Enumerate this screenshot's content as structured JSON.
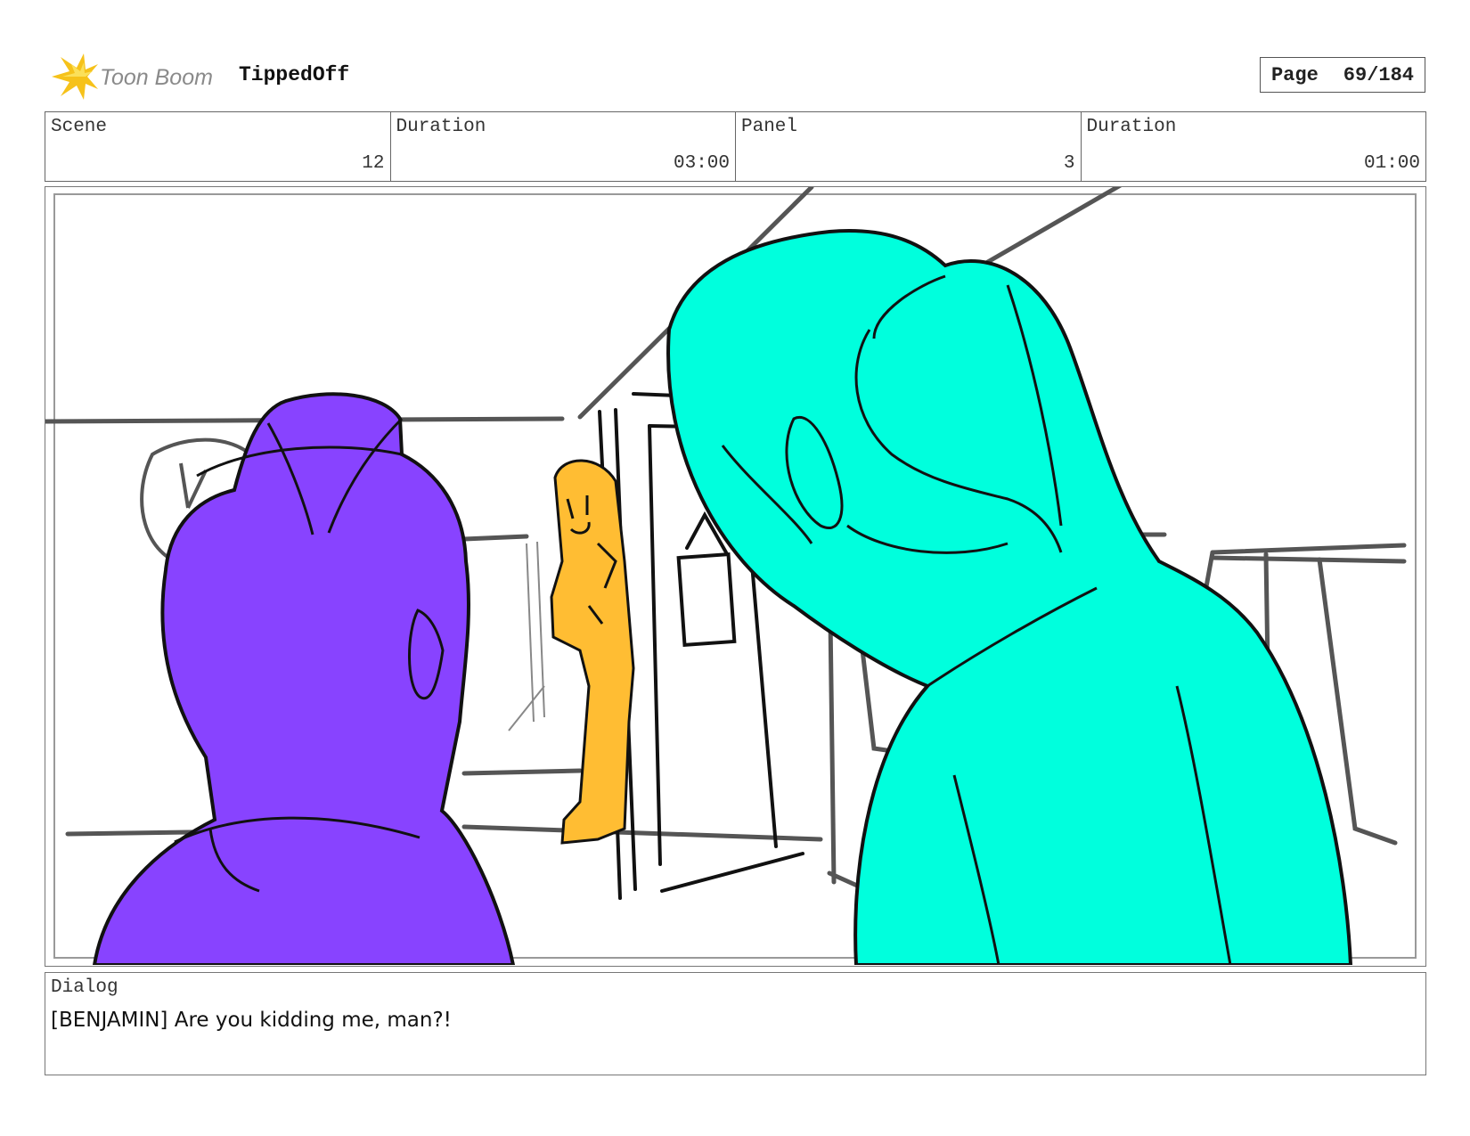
{
  "header": {
    "brand_name": "Toon Boom",
    "project_title": "TippedOff",
    "page_label": "Page",
    "page_number": "69/184"
  },
  "info": {
    "scene_label": "Scene",
    "scene_value": "12",
    "scene_duration_label": "Duration",
    "scene_duration_value": "03:00",
    "panel_label": "Panel",
    "panel_value": "3",
    "panel_duration_label": "Duration",
    "panel_duration_value": "01:00"
  },
  "dialog": {
    "label": "Dialog",
    "text": "[BENJAMIN] Are you kidding me, man?!"
  },
  "colors": {
    "purple_character": "#8843ff",
    "cyan_character": "#00ffdd",
    "yellow_character": "#ffbd33",
    "logo_yellow": "#f6c21a",
    "logo_text": "#8a8a8a"
  }
}
